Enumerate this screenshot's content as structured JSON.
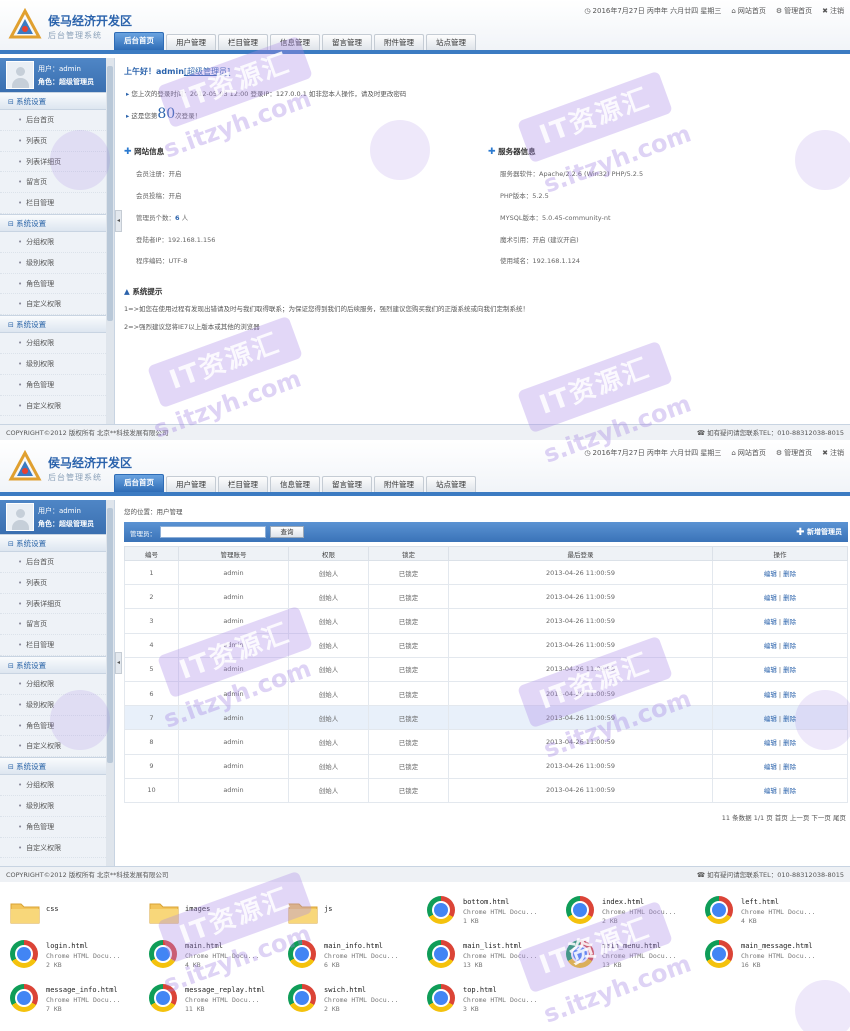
{
  "header": {
    "app_title": "侯马经济开发区",
    "app_subtitle": "后台管理系统",
    "date_text": "2016年7月27日 丙申年 六月廿四 星期三",
    "links": [
      "网站首页",
      "管理首页",
      "注销"
    ]
  },
  "nav_tabs": [
    "后台首页",
    "用户管理",
    "栏目管理",
    "信息管理",
    "留言管理",
    "附件管理",
    "站点管理"
  ],
  "user": {
    "user_line": "用户：admin",
    "role_line": "角色：超级管理员"
  },
  "sidebar": {
    "groups": [
      {
        "title": "系统设置",
        "items": [
          "后台首页",
          "列表页",
          "列表详细页",
          "留言页",
          "栏目管理"
        ]
      },
      {
        "title": "系统设置",
        "items": [
          "分组权限",
          "级别权限",
          "角色管理",
          "自定义权限"
        ]
      },
      {
        "title": "系统设置",
        "items": [
          "分组权限",
          "级别权限",
          "角色管理",
          "自定义权限"
        ]
      }
    ]
  },
  "footer": {
    "copyright": "COPYRIGHT©2012 版权所有 北京**科技发展有限公司",
    "contact": "如有疑问请您联系TEL：010-88312038-8015"
  },
  "dashboard": {
    "greeting": "上午好！admin",
    "greeting_role": "[超级管理员]",
    "last_login": "您上次的登录时间：2012-05-03  12:00 登录IP：127.0.0.1     如非您本人操作，请及时更改密码",
    "visits_prefix": "这是您第",
    "visits_count": "80",
    "visits_suffix": "次登录！",
    "site_info": {
      "title": "网站信息",
      "rows": [
        {
          "label": "会员注册：",
          "value": "开启"
        },
        {
          "label": "会员投稿：",
          "value": "开启"
        },
        {
          "label": "管理员个数：",
          "value": "6",
          "suffix": " 人"
        },
        {
          "label": "登陆者IP：",
          "value": "192.168.1.156"
        },
        {
          "label": "程序编码：",
          "value": "UTF-8"
        }
      ]
    },
    "server_info": {
      "title": "服务器信息",
      "rows": [
        {
          "label": "服务器软件：",
          "value": "Apache/2.2.6 (Win32) PHP/5.2.5"
        },
        {
          "label": "PHP版本：",
          "value": "5.2.5"
        },
        {
          "label": "MYSQL版本：",
          "value": "5.0.45-community-nt"
        },
        {
          "label": "魔术引用：",
          "value": "开启 (建议开启)"
        },
        {
          "label": "使用域名：",
          "value": "192.168.1.124"
        }
      ]
    },
    "notice_title": "系统提示",
    "notices": [
      "1=>如您在使用过程有发现出错请及时与我们取得联系；为保证您得到我们的后续服务，强烈建议您购买我们的正版系统或向我们定制系统！",
      "2=>强烈建议您将IE7以上版本或其他的浏览器"
    ]
  },
  "users_page": {
    "breadcrumb": "您的位置：用户管理",
    "search_label": "管理员：",
    "search_value": "",
    "search_button": "查询",
    "add_button": "新增管理员",
    "columns": [
      "编号",
      "管理账号",
      "权限",
      "锁定",
      "最后登录",
      "操作"
    ],
    "rows": [
      {
        "id": "1",
        "account": "admin",
        "perm": "创始人",
        "lock": "已锁定",
        "last": "2013-04-26 11:00:59"
      },
      {
        "id": "2",
        "account": "admin",
        "perm": "创始人",
        "lock": "已锁定",
        "last": "2013-04-26 11:00:59"
      },
      {
        "id": "3",
        "account": "admin",
        "perm": "创始人",
        "lock": "已锁定",
        "last": "2013-04-26 11:00:59"
      },
      {
        "id": "4",
        "account": "admin",
        "perm": "创始人",
        "lock": "已锁定",
        "last": "2013-04-26 11:00:59"
      },
      {
        "id": "5",
        "account": "admin",
        "perm": "创始人",
        "lock": "已锁定",
        "last": "2013-04-26 11:00:59"
      },
      {
        "id": "6",
        "account": "admin",
        "perm": "创始人",
        "lock": "已锁定",
        "last": "2013-04-26 11:00:59"
      },
      {
        "id": "7",
        "account": "admin",
        "perm": "创始人",
        "lock": "已锁定",
        "last": "2013-04-26 11:00:59"
      },
      {
        "id": "8",
        "account": "admin",
        "perm": "创始人",
        "lock": "已锁定",
        "last": "2013-04-26 11:00:59"
      },
      {
        "id": "9",
        "account": "admin",
        "perm": "创始人",
        "lock": "已锁定",
        "last": "2013-04-26 11:00:59"
      },
      {
        "id": "10",
        "account": "admin",
        "perm": "创始人",
        "lock": "已锁定",
        "last": "2013-04-26 11:00:59"
      }
    ],
    "edit_label": "编辑",
    "delete_label": "删除",
    "pager": "11 条数据 1/1 页  首页  上一页  下一页  尾页"
  },
  "files": [
    {
      "name": "css",
      "kind": "folder"
    },
    {
      "name": "images",
      "kind": "folder"
    },
    {
      "name": "js",
      "kind": "folder"
    },
    {
      "name": "bottom.html",
      "kind": "chrome",
      "type": "Chrome HTML Docu...",
      "size": "1 KB"
    },
    {
      "name": "index.html",
      "kind": "chrome",
      "type": "Chrome HTML Docu...",
      "size": "2 KB"
    },
    {
      "name": "left.html",
      "kind": "chrome",
      "type": "Chrome HTML Docu...",
      "size": "4 KB"
    },
    {
      "name": "login.html",
      "kind": "chrome",
      "type": "Chrome HTML Docu...",
      "size": "2 KB"
    },
    {
      "name": "main.html",
      "kind": "chrome",
      "type": "Chrome HTML Docu...",
      "size": "4 KB"
    },
    {
      "name": "main_info.html",
      "kind": "chrome",
      "type": "Chrome HTML Docu...",
      "size": "6 KB"
    },
    {
      "name": "main_list.html",
      "kind": "chrome",
      "type": "Chrome HTML Docu...",
      "size": "13 KB"
    },
    {
      "name": "main_menu.html",
      "kind": "chrome",
      "type": "Chrome HTML Docu...",
      "size": "13 KB"
    },
    {
      "name": "main_message.html",
      "kind": "chrome",
      "type": "Chrome HTML Docu...",
      "size": "16 KB"
    },
    {
      "name": "message_info.html",
      "kind": "chrome",
      "type": "Chrome HTML Docu...",
      "size": "7 KB"
    },
    {
      "name": "message_replay.html",
      "kind": "chrome",
      "type": "Chrome HTML Docu...",
      "size": "11 KB"
    },
    {
      "name": "swich.html",
      "kind": "chrome",
      "type": "Chrome HTML Docu...",
      "size": "2 KB"
    },
    {
      "name": "top.html",
      "kind": "chrome",
      "type": "Chrome HTML Docu...",
      "size": "3 KB"
    }
  ],
  "watermark": {
    "stamp": "IT资源汇",
    "url": "s.itzyh.com"
  },
  "colors": {
    "accent": "#3c7bc2",
    "link": "#2b63ac",
    "watermark": "#ab8ce8"
  }
}
